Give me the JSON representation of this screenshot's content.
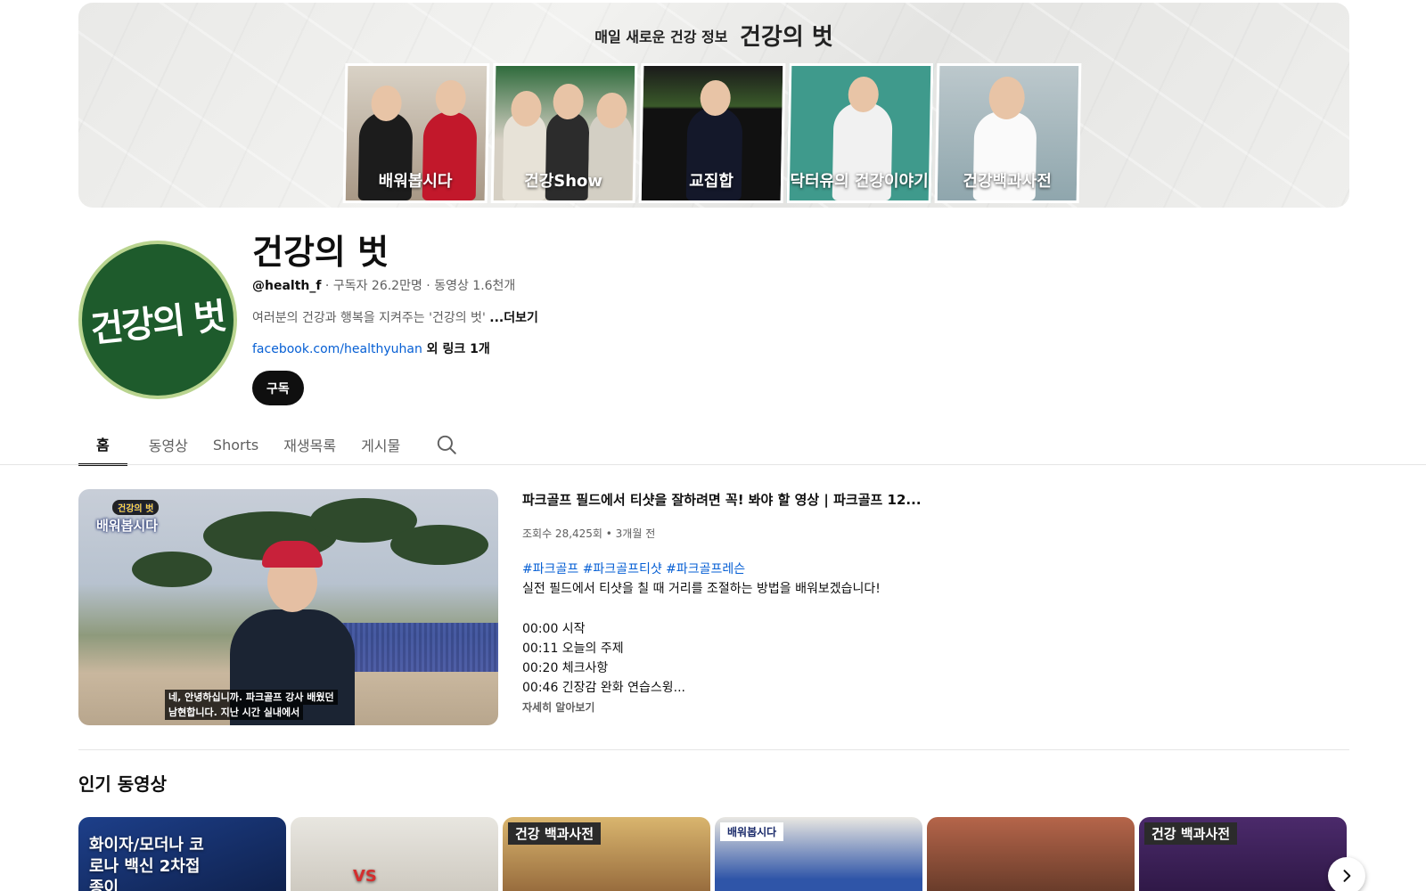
{
  "banner": {
    "tagline": "매일 새로운 건강 정보",
    "brand": "건강의 벗",
    "tiles": [
      {
        "label": "배워봅시다"
      },
      {
        "label": "건강Show"
      },
      {
        "label": "교집합"
      },
      {
        "label": "닥터유의 건강이야기"
      },
      {
        "label": "건강백과사전"
      }
    ]
  },
  "channel": {
    "avatar_text": "건강의 벗",
    "name": "건강의 벗",
    "handle": "@health_f",
    "stats": " · 구독자 26.2만명 · 동영상 1.6천개",
    "description": "여러분의 건강과 행복을 지켜주는 '건강의 벗' ",
    "more_label": "...더보기",
    "link_text": "facebook.com/healthyuhan",
    "extra_links": " 외 링크 1개",
    "subscribe_label": "구독"
  },
  "tabs": [
    {
      "label": "홈",
      "active": true
    },
    {
      "label": "동영상"
    },
    {
      "label": "Shorts"
    },
    {
      "label": "재생목록"
    },
    {
      "label": "게시물"
    }
  ],
  "featured": {
    "thumb_badge_top": "건강의 벗",
    "thumb_badge": "배워봅시다",
    "caption_line1": "네, 안녕하십니까. 파크골프 강사",
    "caption_line2": "남현합니다. 지난 시간 실내에서",
    "caption_extra": "배웠던",
    "title": "파크골프 필드에서 티샷을 잘하려면 꼭! 봐야 할 영상 | 파크골프 12...",
    "stats": "조회수 28,425회 • 3개월 전",
    "hashtags": "#파크골프 #파크골프티샷 #파크골프레슨",
    "summary": "실전 필드에서 티샷을 칠 때 거리를 조절하는 방법을 배워보겠습니다!",
    "chapters": [
      "00:00 시작",
      "00:11 오늘의 주제",
      "00:20 체크사항",
      "00:46 긴장감 완화 연습스윙..."
    ],
    "learn_more": "자세히 알아보기"
  },
  "popular": {
    "title": "인기 동영상",
    "items": [
      {
        "text": "화이자/모더나 코로나 백신 2차접종이",
        "bg": "#1d3f8a"
      },
      {
        "text": "VS",
        "bg": "#d8d4cc"
      },
      {
        "text": "건강 백과사전",
        "bg": "#c7a063"
      },
      {
        "text": "배워봅시다",
        "bg": "#7e8fa6"
      },
      {
        "text": "",
        "bg": "#6b4a34"
      },
      {
        "text": "건강 백과사전",
        "bg": "#3a1f55"
      }
    ]
  },
  "colors": {
    "accent_link": "#065fd4",
    "subscribe_bg": "#0f0f0f",
    "avatar_bg": "#1e5b2c"
  }
}
